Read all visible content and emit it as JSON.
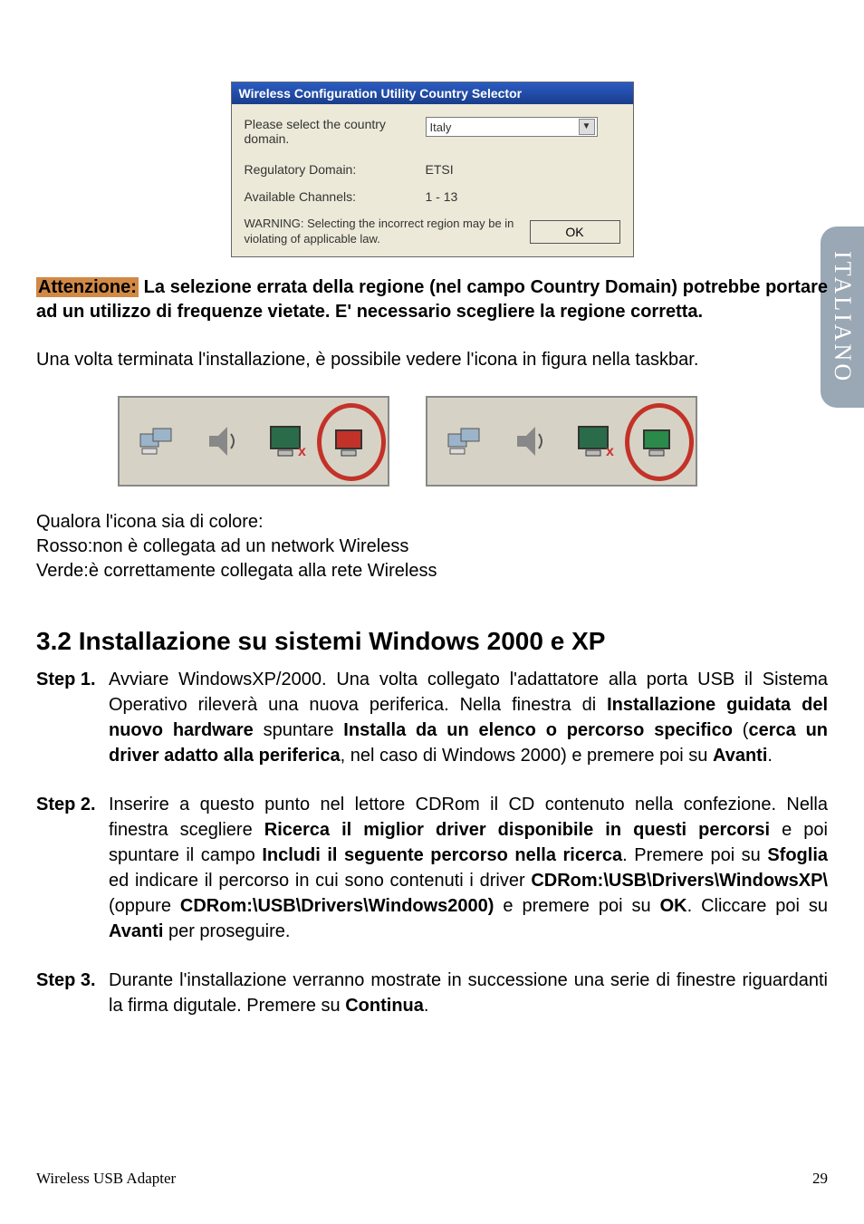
{
  "side_tab": "ITALIANO",
  "dialog": {
    "title": "Wireless Configuration Utility Country Selector",
    "label_country": "Please select the country domain.",
    "value_country": "Italy",
    "label_domain": "Regulatory Domain:",
    "value_domain": "ETSI",
    "label_channels": "Available Channels:",
    "value_channels": "1 - 13",
    "warning": "WARNING: Selecting the incorrect region may be in violating of applicable law.",
    "ok": "OK"
  },
  "attenzione_label": "Attenzione:",
  "attenzione_text": " La selezione errata della regione (nel campo Country Domain) potrebbe portare ad un utilizzo di frequenze vietate. E' necessario scegliere la regione corretta.",
  "post_install_text": "Una volta terminata l'installazione, è possibile vedere l'icona in figura nella taskbar.",
  "icon_color_intro": "Qualora l'icona sia di colore:",
  "icon_color_red": "Rosso:non è collegata ad un network Wireless",
  "icon_color_green": "Verde:è correttamente collegata alla rete Wireless",
  "section_title": "3.2 Installazione su sistemi Windows 2000 e XP",
  "steps": [
    {
      "label": "Step 1.",
      "p1": "Avviare WindowsXP/2000. Una volta collegato l'adattatore alla porta USB il Sistema Operativo rileverà una nuova periferica. Nella finestra di ",
      "b1": "Installazione guidata del nuovo hardware",
      "p2": " spuntare ",
      "b2": "Installa da un elenco o percorso specifico",
      "p3": " (",
      "b3": "cerca un driver adatto alla periferica",
      "p4": ", nel caso di Windows 2000) e premere poi su ",
      "b4": "Avanti",
      "p5": "."
    },
    {
      "label": "Step 2.",
      "p1": "Inserire a questo punto nel lettore CDRom il CD contenuto nella confezione. Nella finestra scegliere ",
      "b1": "Ricerca il miglior driver disponibile in questi percorsi",
      "p2": " e poi spuntare il campo ",
      "b2": "Includi il seguente percorso nella ricerca",
      "p3": ". Premere poi su ",
      "b3": "Sfoglia",
      "p4": " ed indicare il percorso in cui sono contenuti i driver ",
      "b4": "CDRom:\\USB\\Drivers\\WindowsXP\\",
      "p5": " (oppure ",
      "b5": "CDRom:\\USB\\Drivers\\Windows2000)",
      "p6": " e premere poi su ",
      "b6": "OK",
      "p7": ". Cliccare poi su ",
      "b7": "Avanti",
      "p8": " per proseguire."
    },
    {
      "label": "Step 3.",
      "p1": "Durante l'installazione verranno  mostrate in successione una serie di finestre riguardanti la firma digutale.  Premere su ",
      "b1": "Continua",
      "p2": "."
    }
  ],
  "footer_left": "Wireless USB Adapter",
  "footer_right": "29"
}
